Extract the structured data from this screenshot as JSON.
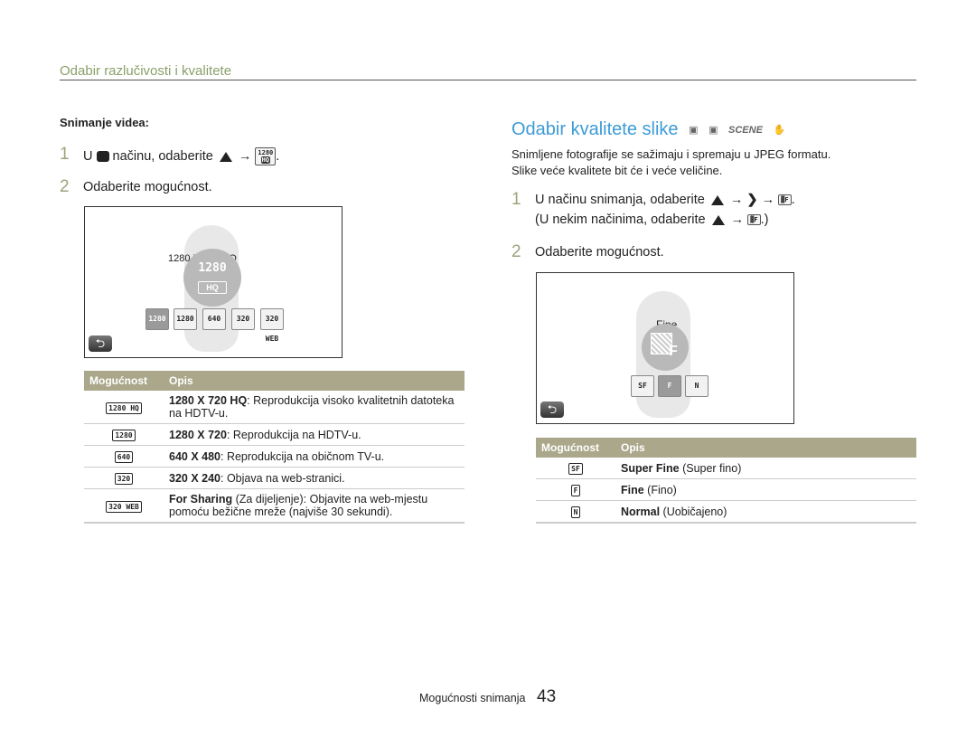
{
  "section_title": "Odabir razlučivosti i kvalitete",
  "left": {
    "subhead": "Snimanje videa:",
    "step1": {
      "num": "1",
      "pre": "U",
      "mid": "načinu, odaberite",
      "arrow": "→"
    },
    "step2": {
      "num": "2",
      "text": "Odaberite mogućnost."
    },
    "screen": {
      "label": "1280 X 720 HQ",
      "circle_top": "1280",
      "circle_bottom": "HQ",
      "options": [
        "1280 HQ",
        "1280",
        "640",
        "320",
        "320 WEB"
      ]
    },
    "table": {
      "headers": [
        "Mogućnost",
        "Opis"
      ],
      "rows": [
        {
          "icon": "1280 HQ",
          "bold": "1280 X 720 HQ",
          "text": ": Reprodukcija visoko kvalitetnih datoteka na HDTV-u."
        },
        {
          "icon": "1280",
          "bold": "1280 X 720",
          "text": ": Reprodukcija na HDTV-u."
        },
        {
          "icon": "640",
          "bold": "640 X 480",
          "text": ": Reprodukcija na običnom TV-u."
        },
        {
          "icon": "320",
          "bold": "320 X 240",
          "text": ": Objava na web-stranici."
        },
        {
          "icon": "320 WEB",
          "bold": "For Sharing",
          "text": " (Za dijeljenje): Objavite na web-mjestu pomoću bežične mreže (najviše 30 sekundi)."
        }
      ]
    }
  },
  "right": {
    "title": "Odabir kvalitete slike",
    "mode_icons": [
      "camera-icon",
      "smart-camera-icon",
      "SCENE",
      "dual-is-icon"
    ],
    "intro_line1": "Snimljene fotografije se sažimaju i spremaju u JPEG formatu.",
    "intro_line2": "Slike veće kvalitete bit će i veće veličine.",
    "step1": {
      "num": "1",
      "line1": "U načinu snimanja, odaberite",
      "line2_pre": "(U nekim načinima, odaberite",
      "line2_post": ".)",
      "arrow": "→"
    },
    "step2": {
      "num": "2",
      "text": "Odaberite mogućnost."
    },
    "screen": {
      "label": "Fine",
      "circle_text": "F",
      "options": [
        "SF",
        "F",
        "N"
      ]
    },
    "table": {
      "headers": [
        "Mogućnost",
        "Opis"
      ],
      "rows": [
        {
          "icon": "SF",
          "bold": "Super Fine",
          "text": " (Super fino)"
        },
        {
          "icon": "F",
          "bold": "Fine",
          "text": " (Fino)"
        },
        {
          "icon": "N",
          "bold": "Normal",
          "text": " (Uobičajeno)"
        }
      ]
    }
  },
  "footer": {
    "text": "Mogućnosti snimanja",
    "page": "43"
  },
  "colors": {
    "accent_title": "#3d9bd6",
    "section_title": "#8aa06a",
    "table_header": "#aaa78a"
  }
}
